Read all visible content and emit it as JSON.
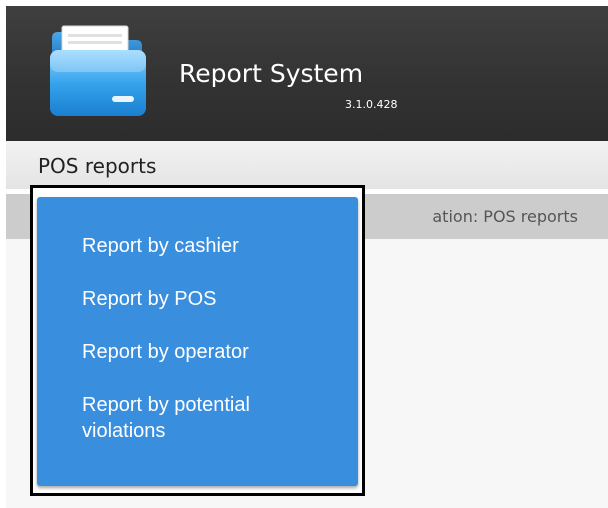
{
  "header": {
    "app_title": "Report System",
    "version": "3.1.0.428",
    "logo_icon": "folder-icon",
    "background_color": "#333333"
  },
  "menu_bar": {
    "active_menu": "POS reports"
  },
  "location_bar": {
    "text": "ation: POS reports"
  },
  "dropdown": {
    "background_color": "#3a8ede",
    "items": [
      {
        "label": "Report by cashier"
      },
      {
        "label": "Report by POS"
      },
      {
        "label": "Report by operator"
      },
      {
        "label": "Report by potential\nviolations"
      }
    ]
  }
}
